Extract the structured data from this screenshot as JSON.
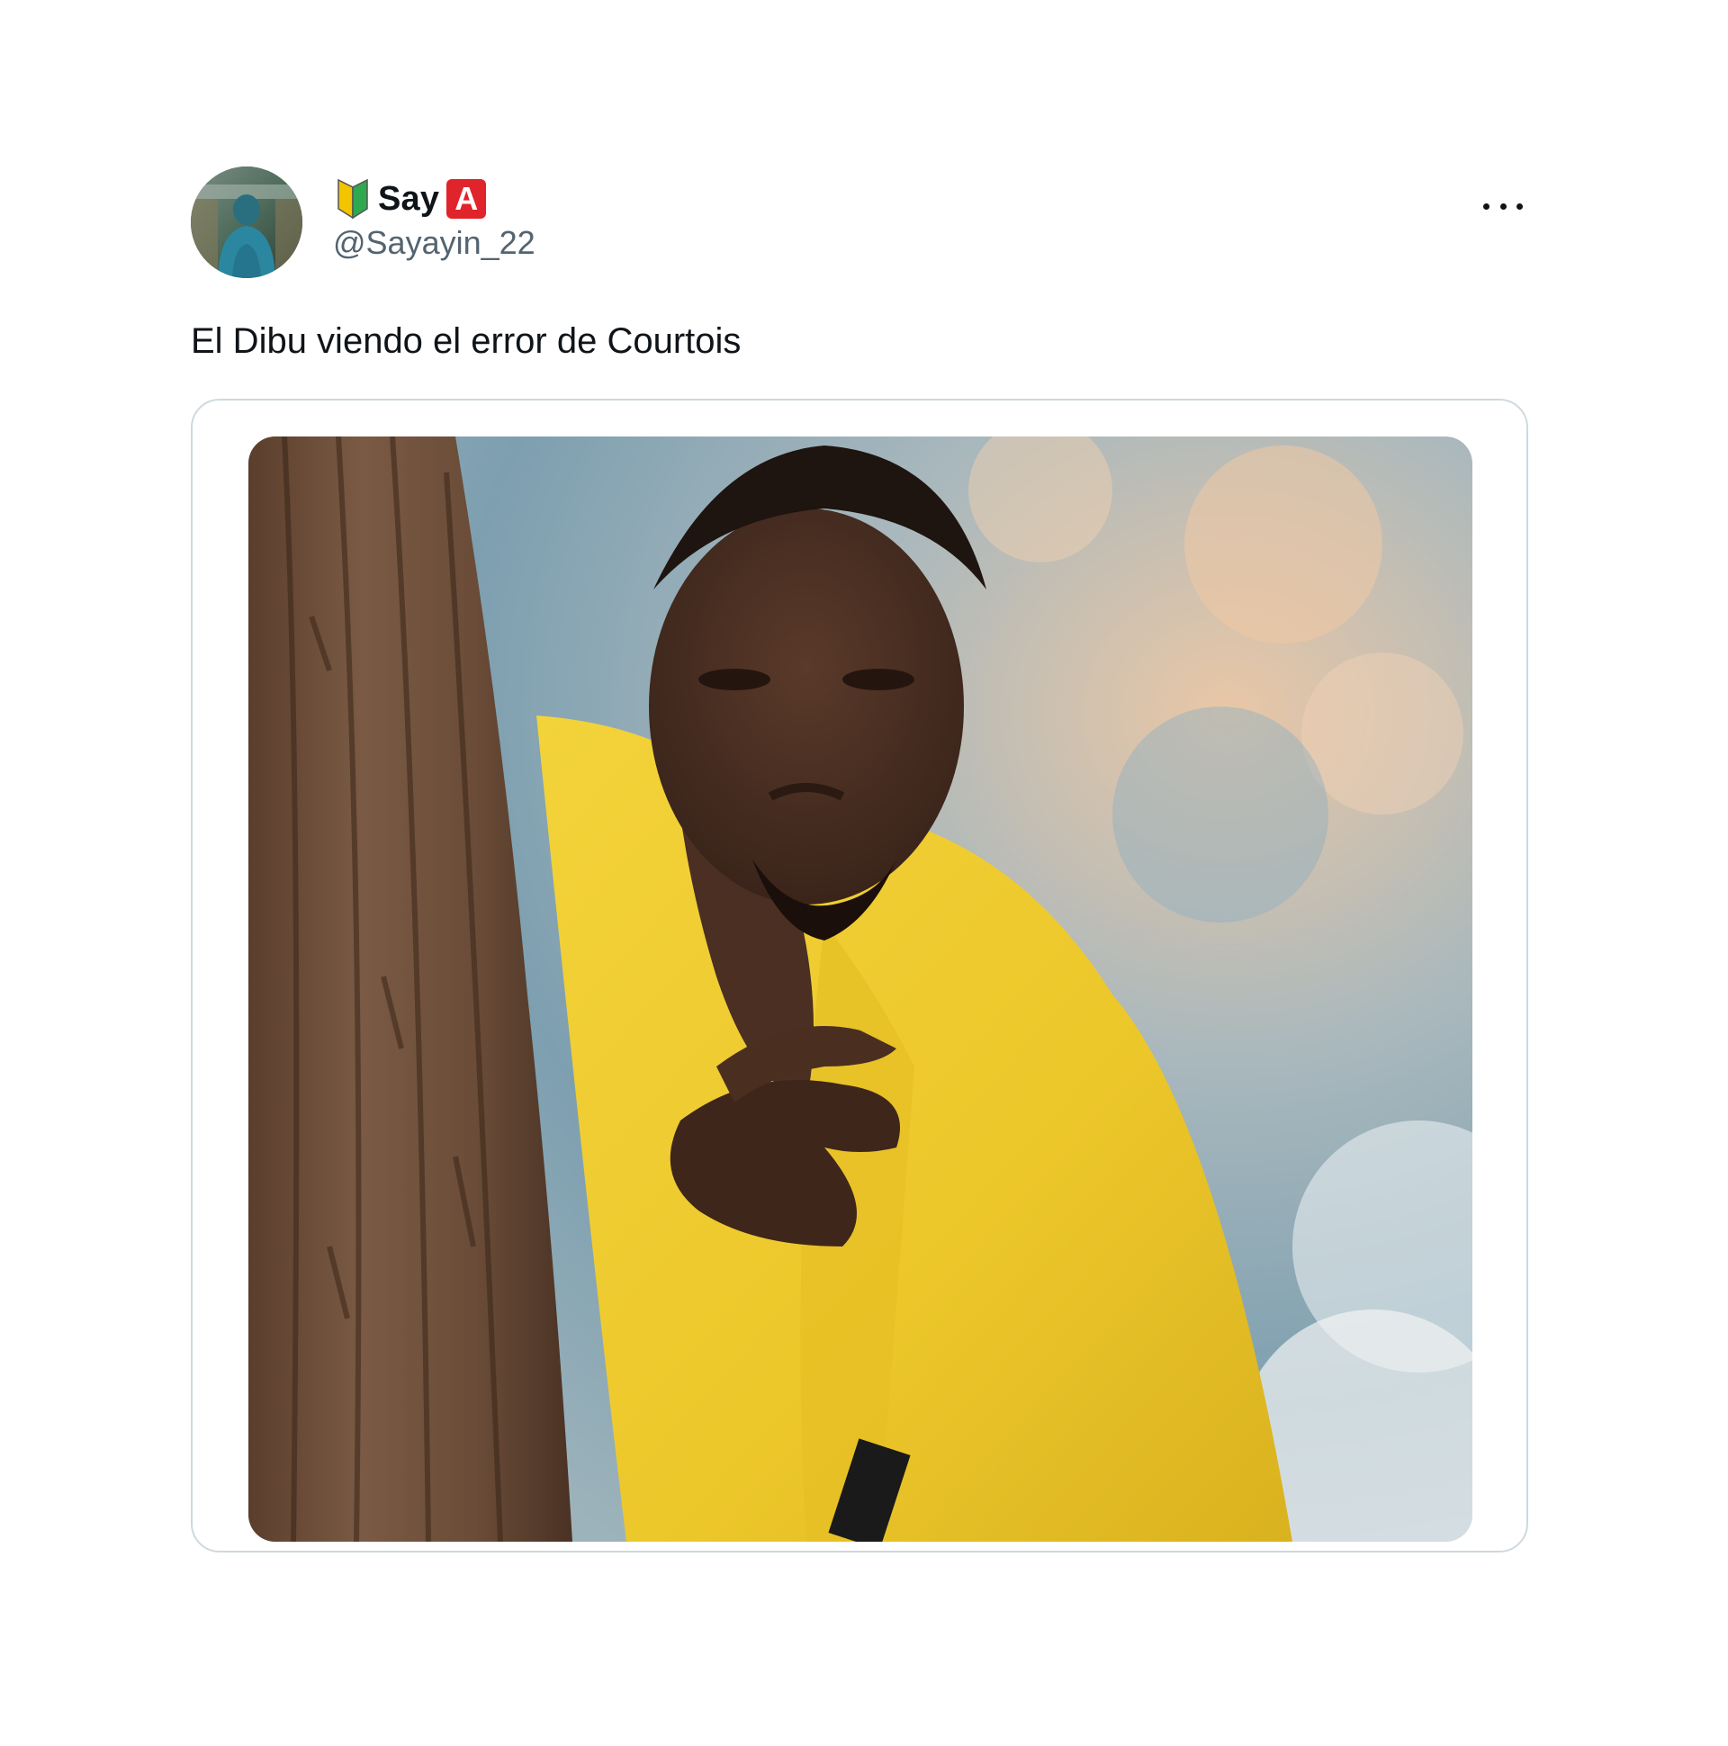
{
  "tweet": {
    "display_name": "Say",
    "name_badge": "A",
    "handle": "@Sayayin_22",
    "text": "El Dibu viendo el error de Courtois",
    "more_menu_icon": "more-horizontal-icon",
    "name_prefix_icon": "beginner-leaf-icon"
  },
  "media": {
    "description_icon": "photo-icon"
  },
  "colors": {
    "badge_red": "#e0242b",
    "handle_gray": "#536471",
    "card_border": "#cfd9de",
    "text": "#0f1419"
  }
}
